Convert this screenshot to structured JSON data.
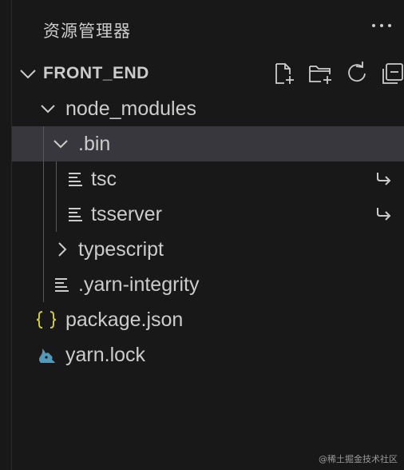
{
  "explorer": {
    "title": "资源管理器",
    "more_icon": "ellipsis-icon"
  },
  "section": {
    "title": "FRONT_END",
    "actions": [
      {
        "name": "new-file-button",
        "icon": "new-file-icon"
      },
      {
        "name": "new-folder-button",
        "icon": "new-folder-icon"
      },
      {
        "name": "refresh-button",
        "icon": "refresh-icon"
      },
      {
        "name": "collapse-all-button",
        "icon": "collapse-all-icon"
      }
    ]
  },
  "tree": [
    {
      "label": "node_modules",
      "type": "folder",
      "expanded": true,
      "depth": 1
    },
    {
      "label": ".bin",
      "type": "folder",
      "expanded": true,
      "depth": 2,
      "selected": true
    },
    {
      "label": "tsc",
      "type": "symlink-file",
      "depth": 3,
      "decoration": "symlink-arrow-icon"
    },
    {
      "label": "tsserver",
      "type": "symlink-file",
      "depth": 3,
      "decoration": "symlink-arrow-icon"
    },
    {
      "label": "typescript",
      "type": "folder",
      "expanded": false,
      "depth": 2
    },
    {
      "label": ".yarn-integrity",
      "type": "file",
      "depth": 2
    },
    {
      "label": "package.json",
      "type": "json-file",
      "depth": 1
    },
    {
      "label": "yarn.lock",
      "type": "yarn-file",
      "depth": 1
    }
  ],
  "colors": {
    "background": "#181818",
    "selection": "#37373d",
    "text": "#cccccc",
    "json_icon": "#cbcb41",
    "yarn_icon": "#519aba"
  },
  "watermark": "@稀土掘金技术社区"
}
